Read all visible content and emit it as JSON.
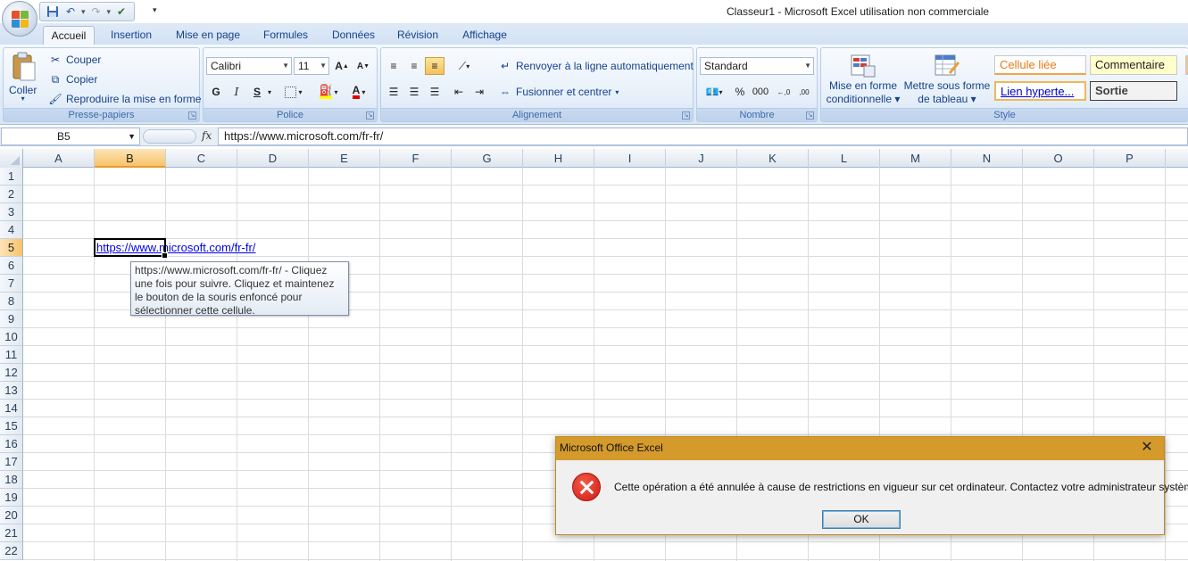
{
  "window": {
    "title": "Classeur1 - Microsoft Excel utilisation non commerciale"
  },
  "tabs": [
    "Accueil",
    "Insertion",
    "Mise en page",
    "Formules",
    "Données",
    "Révision",
    "Affichage"
  ],
  "ribbon": {
    "clipboard": {
      "paste": "Coller",
      "cut": "Couper",
      "copy": "Copier",
      "format_painter": "Reproduire la mise en forme",
      "label": "Presse-papiers"
    },
    "font": {
      "family": "Calibri",
      "size": "11",
      "bold": "G",
      "italic": "I",
      "underline": "S",
      "label": "Police"
    },
    "alignment": {
      "wrap": "Renvoyer à la ligne automatiquement",
      "merge": "Fusionner et centrer",
      "label": "Alignement"
    },
    "number": {
      "format": "Standard",
      "percent": "%",
      "thousands": "000",
      "label": "Nombre"
    },
    "style": {
      "conditional": "Mise en forme conditionnelle",
      "conditional_line1": "Mise en forme",
      "conditional_line2": "conditionnelle",
      "table_line1": "Mettre sous forme",
      "table_line2": "de tableau",
      "cells": [
        "Cellule liée",
        "Commentaire",
        "Lien hyperte...",
        "Sortie"
      ],
      "label": "Style"
    }
  },
  "formula_bar": {
    "name_box": "B5",
    "fx": "fx",
    "content": "https://www.microsoft.com/fr-fr/"
  },
  "grid": {
    "columns": [
      "A",
      "B",
      "C",
      "D",
      "E",
      "F",
      "G",
      "H",
      "I",
      "J",
      "K",
      "L",
      "M",
      "N",
      "O",
      "P"
    ],
    "rows": [
      "1",
      "2",
      "3",
      "4",
      "5",
      "6",
      "7",
      "8",
      "9",
      "10",
      "11",
      "12",
      "13",
      "14",
      "15",
      "16",
      "17",
      "18",
      "19",
      "20",
      "21",
      "22"
    ],
    "selected_column": "B",
    "selected_row": "5",
    "cell_b5": "https://www.microsoft.com/fr-fr/"
  },
  "tooltip": {
    "line1": "https://www.microsoft.com/fr-fr/ - Cliquez",
    "line2": "une fois pour suivre. Cliquez et maintenez",
    "line3": "le bouton de la souris enfoncé pour",
    "line4": "sélectionner cette cellule."
  },
  "dialog": {
    "title": "Microsoft Office Excel",
    "message": "Cette opération a été annulée à cause de restrictions en vigueur sur cet ordinateur. Contactez votre administrateur système.",
    "ok": "OK",
    "icon": "error-icon"
  },
  "colors": {
    "dialog_title": "#d49a2b",
    "link": "#0000ee",
    "selected_header": "#f9c36a",
    "ribbon": "#dbe6f4"
  }
}
